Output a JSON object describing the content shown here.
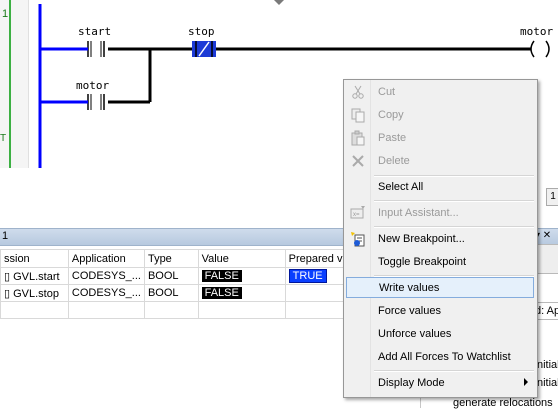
{
  "editor": {
    "rung_number": "1",
    "gutter_fragment": "T",
    "contacts": [
      "start",
      "stop",
      "motor"
    ],
    "coil": "motor",
    "scroll_fragment": "1"
  },
  "watch": {
    "title": "1",
    "columns": [
      "ssion",
      "Application",
      "Type",
      "Value",
      "Prepared v"
    ],
    "rows": [
      {
        "expression": "GVL.start",
        "application": "CODESYS_...",
        "type": "BOOL",
        "value": "FALSE",
        "prepared": "TRUE"
      },
      {
        "expression": "GVL.stop",
        "application": "CODESYS_...",
        "type": "BOOL",
        "value": "FALSE",
        "prepared": ""
      }
    ]
  },
  "right_panel": {
    "field_fragment": "d: Ap",
    "lines": [
      "nitiali",
      "nitiali",
      "generate relocations"
    ]
  },
  "context_menu": {
    "items": [
      {
        "label": "Cut",
        "icon": "scissors-icon",
        "enabled": false
      },
      {
        "label": "Copy",
        "icon": "copy-icon",
        "enabled": false
      },
      {
        "label": "Paste",
        "icon": "paste-icon",
        "enabled": false
      },
      {
        "label": "Delete",
        "icon": "delete-icon",
        "enabled": false
      },
      {
        "label": "Select All",
        "icon": "",
        "enabled": true
      },
      {
        "label": "Input Assistant...",
        "icon": "input-assistant-icon",
        "enabled": false
      },
      {
        "label": "New Breakpoint...",
        "icon": "new-breakpoint-icon",
        "enabled": true
      },
      {
        "label": "Toggle Breakpoint",
        "icon": "",
        "enabled": true
      },
      {
        "label": "Write values",
        "icon": "",
        "enabled": true,
        "highlighted": true
      },
      {
        "label": "Force values",
        "icon": "",
        "enabled": true
      },
      {
        "label": "Unforce values",
        "icon": "",
        "enabled": true
      },
      {
        "label": "Add All Forces To Watchlist",
        "icon": "",
        "enabled": true
      },
      {
        "label": "Display Mode",
        "icon": "",
        "enabled": true,
        "submenu": true
      }
    ]
  },
  "colors": {
    "rail_blue": "#0000ff",
    "highlight": "#e5f0fb",
    "prepared_true": "#0a3fff"
  }
}
